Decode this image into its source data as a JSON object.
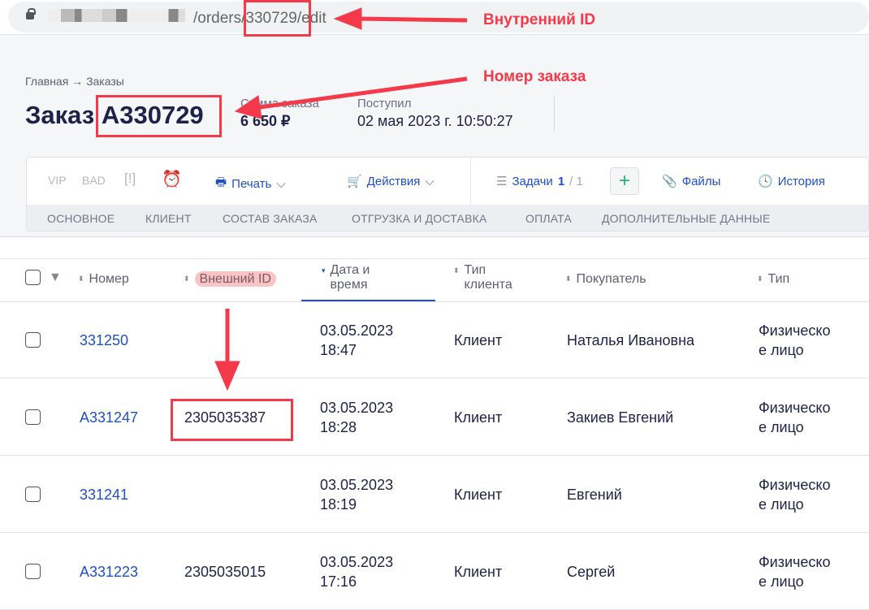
{
  "browser": {
    "url": "/orders/330729/edit"
  },
  "header": {
    "breadcrumb": "Главная → Заказы",
    "title_prefix": "Заказ",
    "order_number": "A330729",
    "sum_label": "Сумма заказа",
    "sum_value": "6 650 ₽",
    "received_label": "Поступил",
    "received_value": "02 мая 2023 г. 10:50:27"
  },
  "toolbar": {
    "vip": "VIP",
    "bad": "BAD",
    "print": "Печать",
    "actions": "Действия",
    "tasks": "Задачи",
    "tasks_done": "1",
    "tasks_total": "/ 1",
    "add": "+",
    "files": "Файлы",
    "history": "История"
  },
  "tabs": [
    "ОСНОВНОЕ",
    "КЛИЕНТ",
    "СОСТАВ ЗАКАЗА",
    "ОТГРУЗКА И ДОСТАВКА",
    "ОПЛАТА",
    "ДОПОЛНИТЕЛЬНЫЕ ДАННЫЕ"
  ],
  "table": {
    "columns": [
      "Номер",
      "Внешний ID",
      "Дата и время",
      "Тип клиента",
      "Покупатель",
      "Тип"
    ],
    "rows": [
      {
        "number": "331250",
        "external_id": "",
        "date": "03.05.2023",
        "time": "18:47",
        "client_type": "Клиент",
        "buyer": "Наталья Ивановна",
        "type1": "Физическо",
        "type2": "е лицо"
      },
      {
        "number": "A331247",
        "external_id": "2305035387",
        "date": "03.05.2023",
        "time": "18:28",
        "client_type": "Клиент",
        "buyer": "Закиев Евгений",
        "type1": "Физическо",
        "type2": "е лицо"
      },
      {
        "number": "331241",
        "external_id": "",
        "date": "03.05.2023",
        "time": "18:19",
        "client_type": "Клиент",
        "buyer": "Евгений",
        "type1": "Физическо",
        "type2": "е лицо"
      },
      {
        "number": "A331223",
        "external_id": "2305035015",
        "date": "03.05.2023",
        "time": "17:16",
        "client_type": "Клиент",
        "buyer": "Сергей",
        "type1": "Физическо",
        "type2": "е лицо"
      }
    ]
  },
  "annotations": {
    "internal_id": "Внутренний ID",
    "order_number": "Номер заказа"
  },
  "colors": {
    "accent": "#1f4fc9",
    "annotation": "#f43a4a",
    "add": "#22b573"
  }
}
